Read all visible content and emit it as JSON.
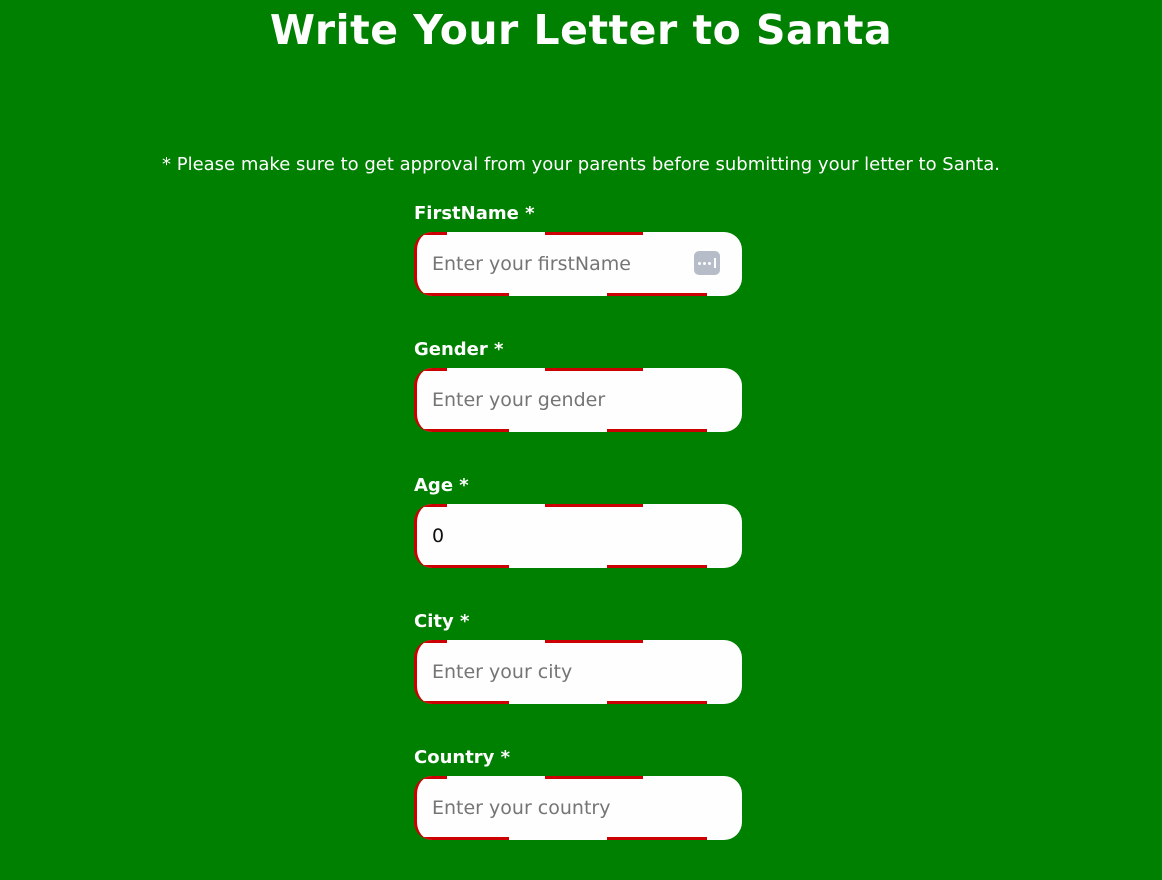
{
  "header": {
    "title": "Write Your Letter to Santa"
  },
  "notice": "* Please make sure to get approval from your parents before submitting your letter to Santa.",
  "form": {
    "fields": [
      {
        "label": "FirstName *",
        "placeholder": "Enter your firstName",
        "value": ""
      },
      {
        "label": "Gender *",
        "placeholder": "Enter your gender",
        "value": ""
      },
      {
        "label": "Age *",
        "placeholder": "",
        "value": "0"
      },
      {
        "label": "City *",
        "placeholder": "Enter your city",
        "value": ""
      },
      {
        "label": "Country *",
        "placeholder": "Enter your country",
        "value": ""
      }
    ]
  },
  "icons": {
    "autofill": "password-manager-autofill-icon"
  },
  "colors": {
    "background": "#008000",
    "border_stripe": "#cc0000",
    "text": "#ffffff"
  }
}
